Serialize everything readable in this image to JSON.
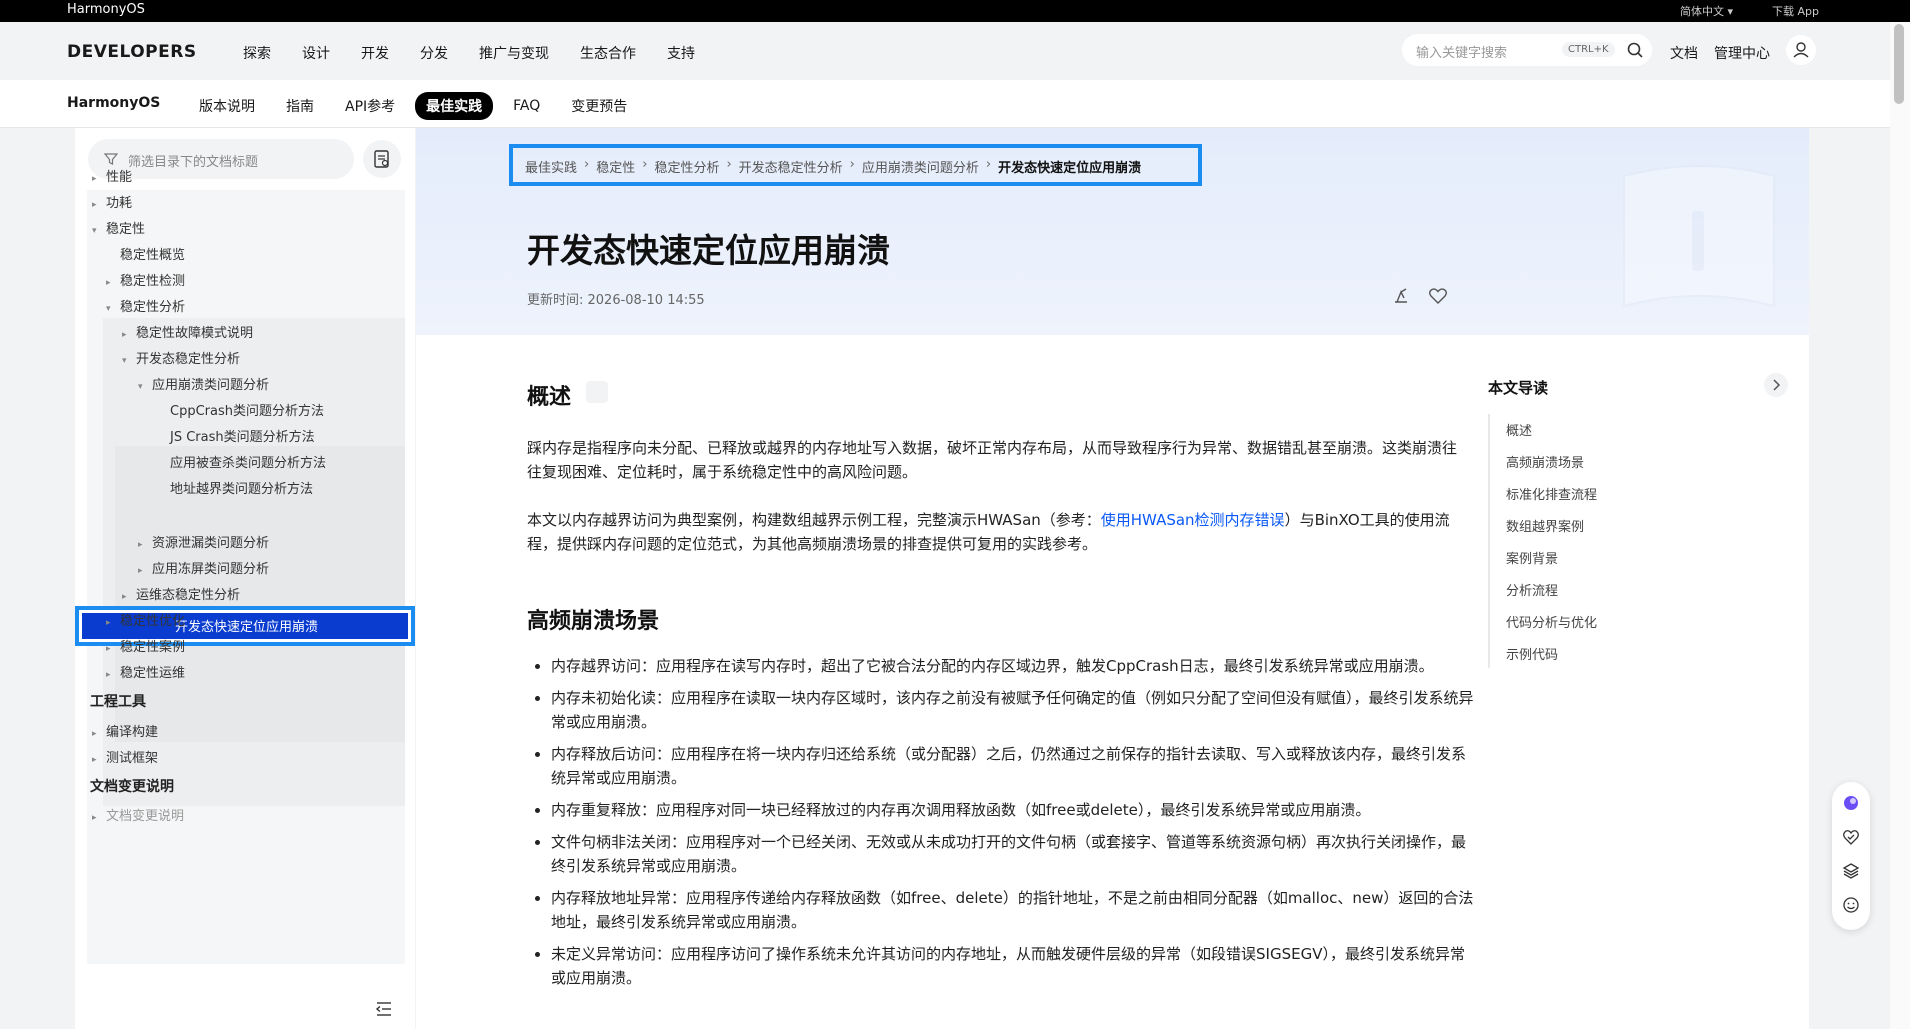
{
  "topbar": {
    "brand": "HarmonyOS",
    "language": "简体中文 ▾",
    "download": "下载 App"
  },
  "header": {
    "logo": "DEVELOPERS",
    "nav": [
      "探索",
      "设计",
      "开发",
      "分发",
      "推广与变现",
      "生态合作",
      "支持"
    ],
    "search_placeholder": "输入关键字搜索",
    "search_shortcut": "CTRL+K",
    "docs": "文档",
    "console": "管理中心"
  },
  "subheader": {
    "product": "HarmonyOS",
    "tabs": [
      "版本说明",
      "指南",
      "API参考",
      "最佳实践",
      "FAQ",
      "变更预告"
    ],
    "active_tab": "最佳实践"
  },
  "sidebar": {
    "filter_placeholder": "筛选目录下的文档标题",
    "tree": [
      {
        "label": "性能",
        "expander": "▸"
      },
      {
        "label": "功耗",
        "expander": "▸"
      },
      {
        "label": "稳定性",
        "expander": "▾"
      },
      {
        "label": "稳定性概览",
        "expander": ""
      },
      {
        "label": "稳定性检测",
        "expander": "▸"
      },
      {
        "label": "稳定性分析",
        "expander": "▾"
      },
      {
        "label": "稳定性故障模式说明",
        "expander": "▸"
      },
      {
        "label": "开发态稳定性分析",
        "expander": "▾"
      },
      {
        "label": "应用崩溃类问题分析",
        "expander": "▾"
      },
      {
        "label": "CppCrash类问题分析方法",
        "expander": ""
      },
      {
        "label": "JS Crash类问题分析方法",
        "expander": ""
      },
      {
        "label": "应用被查杀类问题分析方法",
        "expander": ""
      },
      {
        "label": "地址越界类问题分析方法",
        "expander": ""
      },
      {
        "label": "开发态快速定位应用崩溃",
        "expander": ""
      },
      {
        "label": "资源泄漏类问题分析",
        "expander": "▸"
      },
      {
        "label": "应用冻屏类问题分析",
        "expander": "▸"
      },
      {
        "label": "运维态稳定性分析",
        "expander": "▸"
      },
      {
        "label": "稳定性优化",
        "expander": "▸"
      },
      {
        "label": "稳定性案例",
        "expander": "▸"
      },
      {
        "label": "稳定性运维",
        "expander": "▸"
      },
      {
        "label": "工程工具",
        "expander": ""
      },
      {
        "label": "编译构建",
        "expander": "▸"
      },
      {
        "label": "测试框架",
        "expander": "▸"
      },
      {
        "label": "文档变更说明",
        "expander": ""
      },
      {
        "label": "文档变更说明",
        "expander": "▸"
      }
    ]
  },
  "article": {
    "breadcrumb": [
      "最佳实践",
      "稳定性",
      "稳定性分析",
      "开发态稳定性分析",
      "应用崩溃类问题分析",
      "开发态快速定位应用崩溃"
    ],
    "title": "开发态快速定位应用崩溃",
    "updated": "更新时间: 2026-08-10 14:55",
    "section1_title": "概述",
    "p1": "踩内存是指程序向未分配、已释放或越界的内存地址写入数据，破坏正常内存布局，从而导致程序行为异常、数据错乱甚至崩溃。这类崩溃往往复现困难、定位耗时，属于系统稳定性中的高风险问题。",
    "p2_before": "本文以内存越界访问为典型案例，构建数组越界示例工程，完整演示HWASan（参考：",
    "p2_link": "使用HWASan检测内存错误",
    "p2_after": "）与BinXO工具的使用流程，提供踩内存问题的定位范式，为其他高频崩溃场景的排查提供可复用的实践参考。",
    "section2_title": "高频崩溃场景",
    "bullets": [
      "内存越界访问：应用程序在读写内存时，超出了它被合法分配的内存区域边界，触发CppCrash日志，最终引发系统异常或应用崩溃。",
      "内存未初始化读：应用程序在读取一块内存区域时，该内存之前没有被赋予任何确定的值（例如只分配了空间但没有赋值），最终引发系统异常或应用崩溃。",
      "内存释放后访问：应用程序在将一块内存归还给系统（或分配器）之后，仍然通过之前保存的指针去读取、写入或释放该内存，最终引发系统异常或应用崩溃。",
      "内存重复释放：应用程序对同一块已经释放过的内存再次调用释放函数（如free或delete），最终引发系统异常或应用崩溃。",
      "文件句柄非法关闭：应用程序对一个已经关闭、无效或从未成功打开的文件句柄（或套接字、管道等系统资源句柄）再次执行关闭操作，最终引发系统异常或应用崩溃。",
      "内存释放地址异常：应用程序传递给内存释放函数（如free、delete）的指针地址，不是之前由相同分配器（如malloc、new）返回的合法地址，最终引发系统异常或应用崩溃。",
      "未定义异常访问：应用程序访问了操作系统未允许其访问的内存地址，从而触发硬件层级的异常（如段错误SIGSEGV），最终引发系统异常或应用崩溃。"
    ]
  },
  "toc": {
    "title": "本文导读",
    "items": [
      "概述",
      "高频崩溃场景",
      "标准化排查流程",
      "数组越界案例",
      "案例背景",
      "分析流程",
      "代码分析与优化",
      "示例代码"
    ]
  },
  "colors": {
    "accent_link": "#0a59f7",
    "highlight_border": "#1b8cf0",
    "selected_bg": "#0a3ccf"
  }
}
